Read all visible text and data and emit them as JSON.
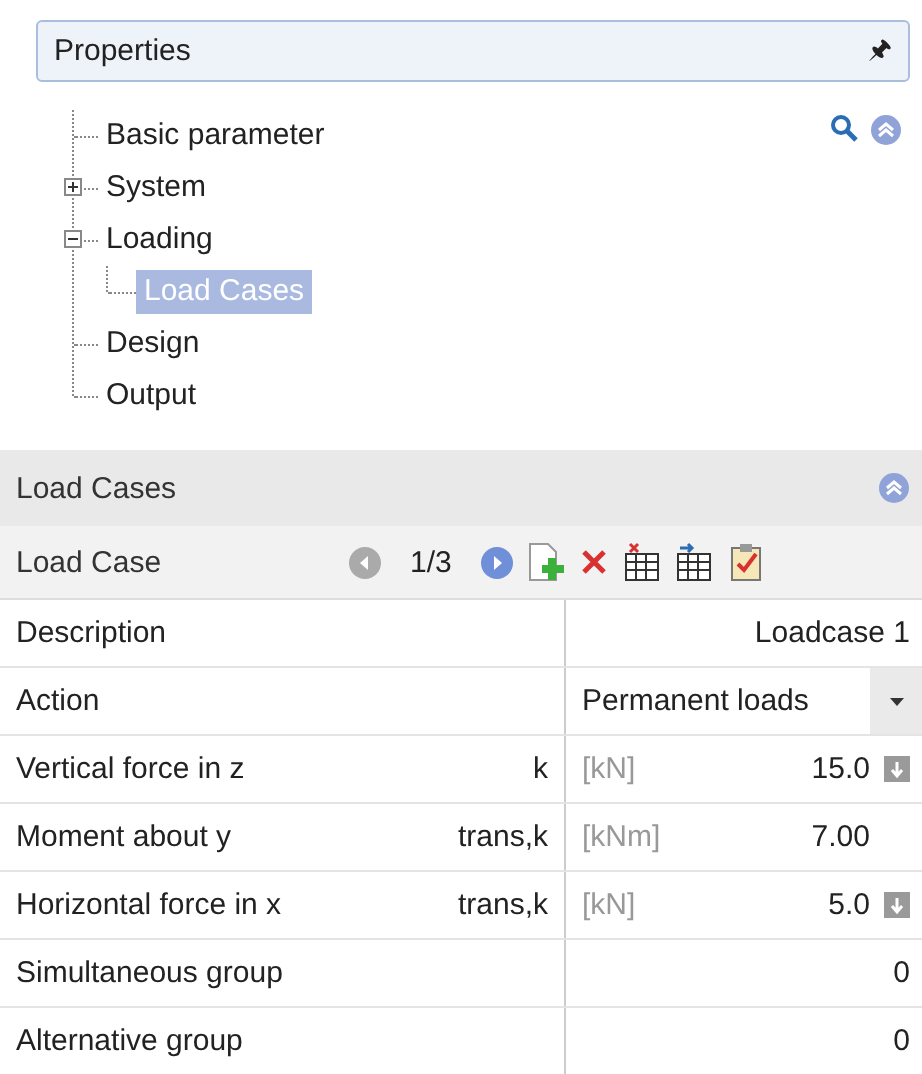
{
  "properties_panel": {
    "title": "Properties",
    "pin": "🖈"
  },
  "tree": [
    {
      "label": "Basic parameter",
      "selected": false
    },
    {
      "label": "System",
      "expanded": false,
      "selected": false
    },
    {
      "label": "Loading",
      "expanded": true,
      "selected": false,
      "children": [
        {
          "label": "Load Cases",
          "selected": true
        }
      ]
    },
    {
      "label": "Design",
      "selected": false
    },
    {
      "label": "Output",
      "selected": false
    }
  ],
  "section": {
    "title": "Load Cases"
  },
  "toolbar": {
    "label": "Load Case",
    "counter": "1/3"
  },
  "rows": [
    {
      "kind": "text",
      "label": "Description",
      "value": "Loadcase 1"
    },
    {
      "kind": "dropdown",
      "label": "Action",
      "value": "Permanent loads"
    },
    {
      "kind": "quantity",
      "label": "Vertical force in z",
      "subscript": "k",
      "unit": "[kN]",
      "value": "15.0",
      "has_button": true
    },
    {
      "kind": "quantity",
      "label": "Moment about y",
      "subscript": "trans,k",
      "unit": "[kNm]",
      "value": "7.00",
      "has_button": false
    },
    {
      "kind": "quantity",
      "label": "Horizontal force in x",
      "subscript": "trans,k",
      "unit": "[kN]",
      "value": "5.0",
      "has_button": true
    },
    {
      "kind": "text",
      "label": "Simultaneous group",
      "value": "0"
    },
    {
      "kind": "text",
      "label": "Alternative group",
      "value": "0"
    }
  ]
}
